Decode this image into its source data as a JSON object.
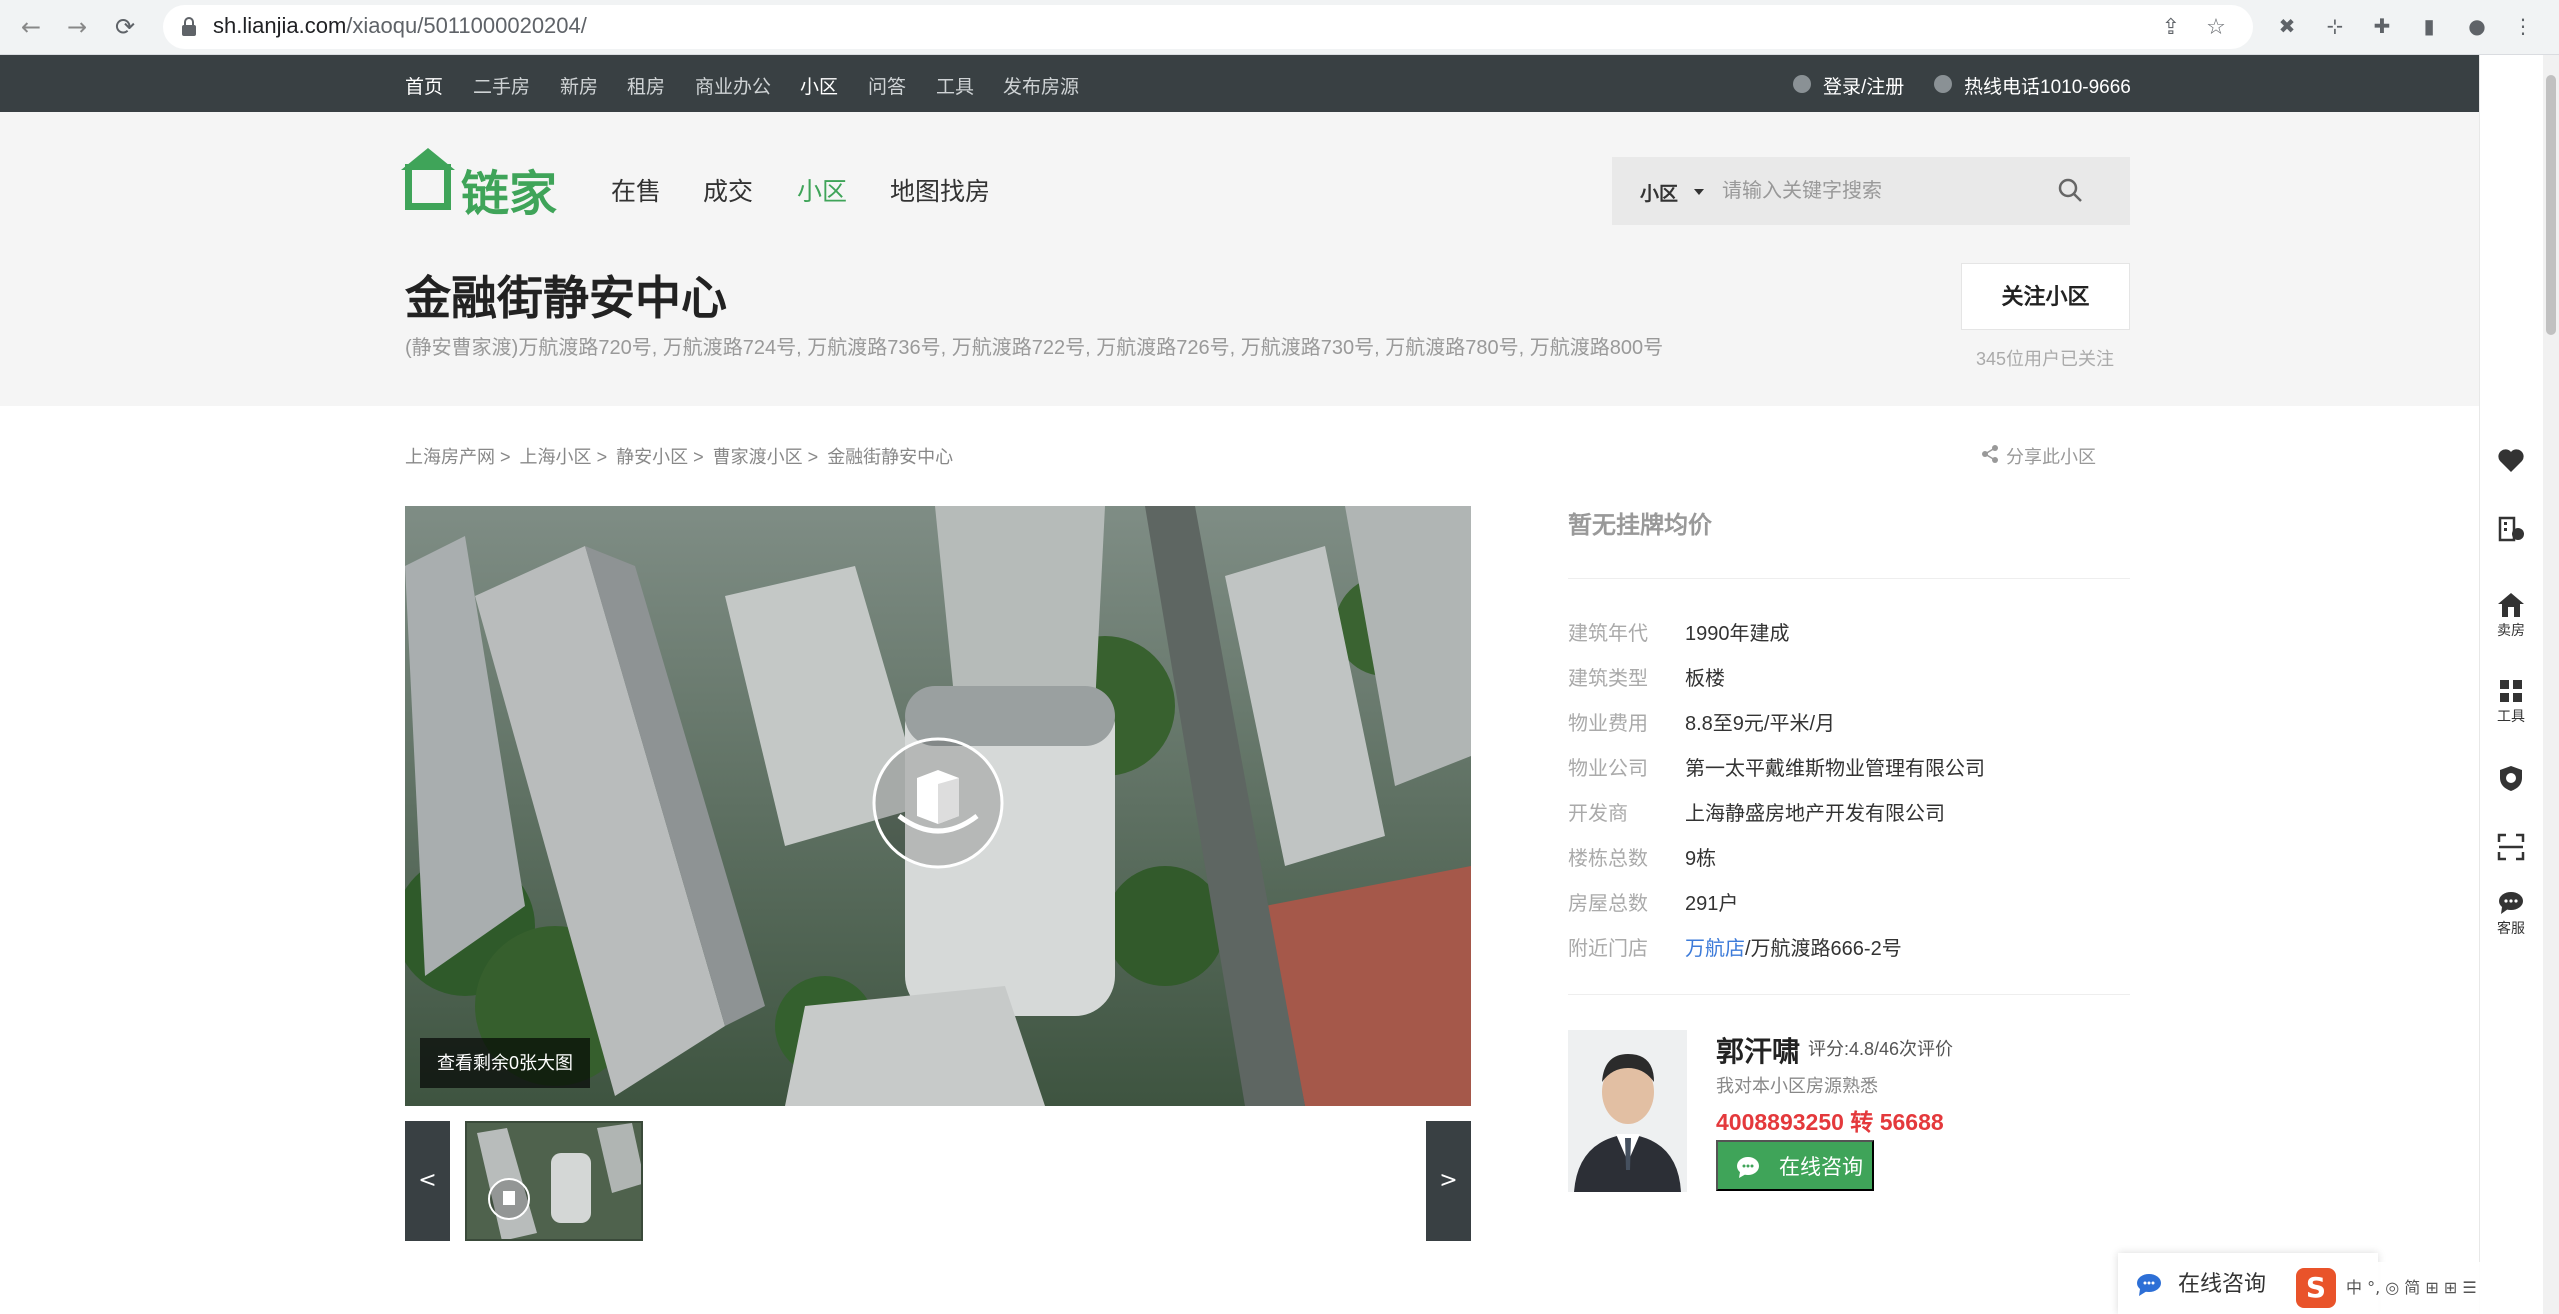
{
  "browser": {
    "url_host": "sh.lianjia.com",
    "url_path": "/xiaoqu/5011000020204/"
  },
  "topbar": {
    "items": [
      "首页",
      "二手房",
      "新房",
      "租房",
      "商业办公",
      "小区",
      "问答",
      "工具",
      "发布房源"
    ],
    "login": "登录/注册",
    "hotline": "热线电话1010-9666"
  },
  "header": {
    "logo_text": "链家",
    "nav": [
      "在售",
      "成交",
      "小区",
      "地图找房"
    ],
    "search_category": "小区",
    "search_placeholder": "请输入关键字搜索",
    "title": "金融街静安中心",
    "address": "(静安曹家渡)万航渡路720号, 万航渡路724号, 万航渡路736号, 万航渡路722号, 万航渡路726号, 万航渡路730号, 万航渡路780号, 万航渡路800号",
    "follow_button": "关注小区",
    "follow_count": "345位用户已关注"
  },
  "breadcrumb": [
    "上海房产网",
    "上海小区",
    "静安小区",
    "曹家渡小区",
    "金融街静安中心"
  ],
  "breadcrumb_sep": ">",
  "share": "分享此小区",
  "gallery": {
    "badge": "查看剩余0张大图",
    "prev": "<",
    "next": ">"
  },
  "info": {
    "price": "暂无挂牌均价",
    "rows": [
      {
        "label": "建筑年代",
        "value": "1990年建成"
      },
      {
        "label": "建筑类型",
        "value": "板楼"
      },
      {
        "label": "物业费用",
        "value": "8.8至9元/平米/月"
      },
      {
        "label": "物业公司",
        "value": "第一太平戴维斯物业管理有限公司"
      },
      {
        "label": "开发商",
        "value": "上海静盛房地产开发有限公司"
      },
      {
        "label": "楼栋总数",
        "value": "9栋"
      },
      {
        "label": "房屋总数",
        "value": "291户"
      },
      {
        "label": "附近门店",
        "link": "万航店",
        "value": "/万航渡路666-2号"
      }
    ]
  },
  "agent": {
    "name": "郭汗啸",
    "score": "评分:4.8/46次评价",
    "desc": "我对本小区房源熟悉",
    "phone": "4008893250 转 56688",
    "consult": "在线咨询"
  },
  "sidebar": {
    "sell": "卖房",
    "tools": "工具",
    "service": "客服"
  },
  "chat_widget": "在线咨询",
  "ime_text": "中 °, ◎ 简 ⊞ ⊞ ☰",
  "colors": {
    "brand": "#3fa459",
    "topbar": "#394043",
    "link": "#3d7bd9",
    "phone": "#e4393c"
  }
}
